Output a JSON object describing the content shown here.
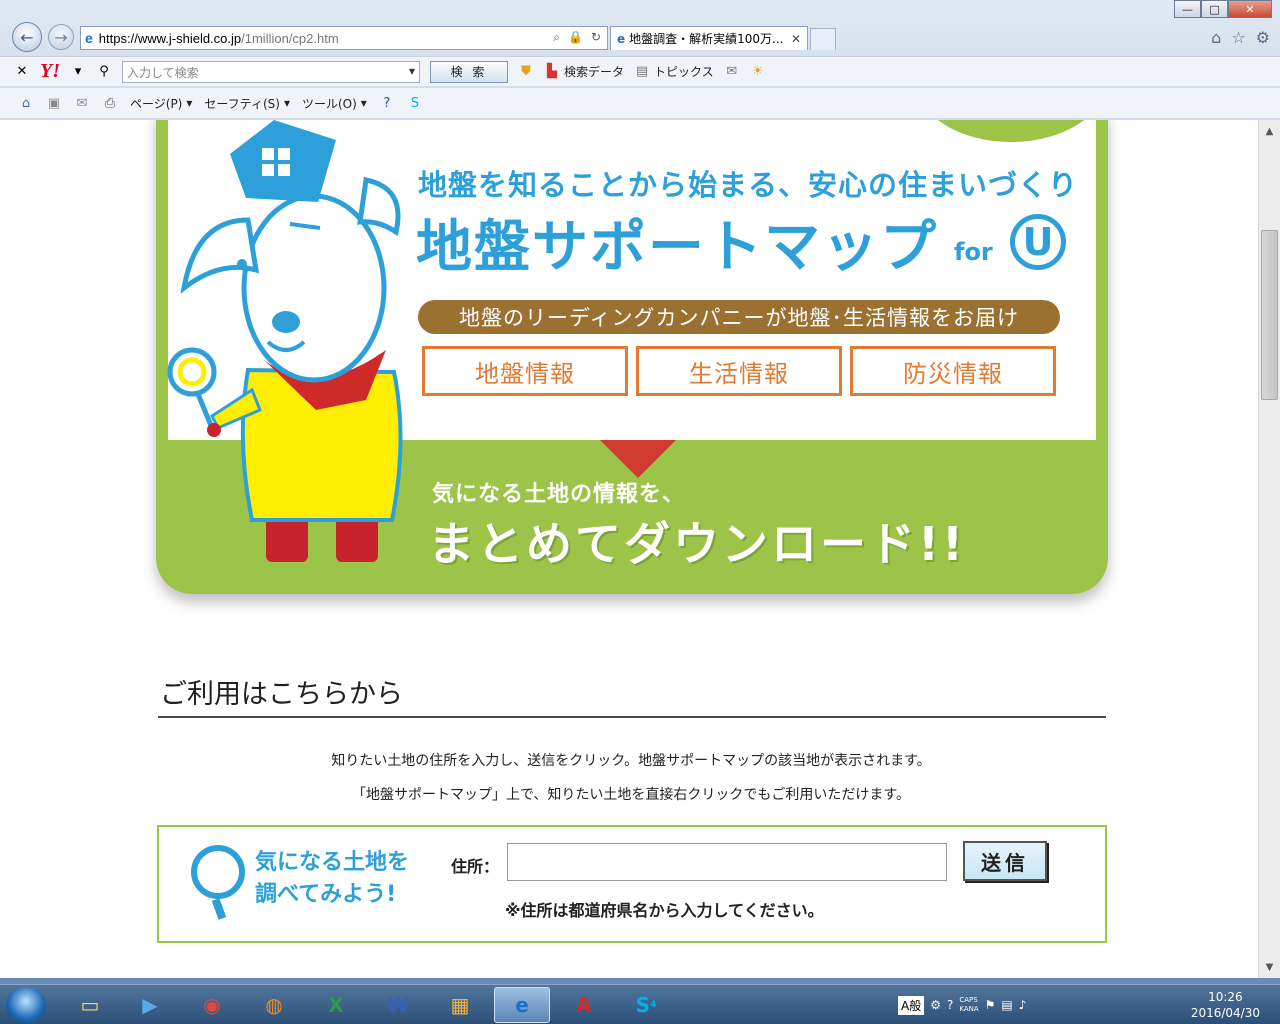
{
  "browser": {
    "url_host": "https://www.j-shield.co.jp",
    "url_path": "/1million/cp2.htm",
    "tab_title": "地盤調査・解析実績100万...",
    "window_buttons": [
      "—",
      "□",
      "✕"
    ]
  },
  "yahoo_toolbar": {
    "search_placeholder": "入力して検索",
    "search_button": "検 索",
    "search_data_label": "検索データ",
    "topics_label": "トピックス"
  },
  "command_bar": {
    "page_menu": "ページ(P)",
    "safety_menu": "セーフティ(S)",
    "tools_menu": "ツール(O)"
  },
  "banner": {
    "tagline": "地盤を知ることから始まる、安心の住まいづくり",
    "title": "地盤サポートマップ",
    "title_for": "for",
    "title_u": "U",
    "pill": "地盤のリーディングカンパニーが地盤･生活情報をお届け",
    "categories": [
      "地盤情報",
      "生活情報",
      "防災情報"
    ],
    "sub": "気になる土地の情報を、",
    "big": "まとめてダウンロード!!"
  },
  "section": {
    "title": "ご利用はこちらから",
    "desc1": "知りたい土地の住所を入力し、送信をクリック。地盤サポートマップの該当地が表示されます。",
    "desc2": "「地盤サポートマップ」上で、知りたい土地を直接右クリックでもご利用いただけます。"
  },
  "form": {
    "cta_line1": "気になる土地を",
    "cta_line2": "調べてみよう!",
    "address_label": "住所：",
    "address_value": "",
    "submit_label": "送信",
    "note": "※住所は都道府県名から入力してください。"
  },
  "taskbar": {
    "ime_mode": "A般",
    "caps": "CAPS",
    "kana": "KANA",
    "time": "10:26",
    "date": "2016/04/30",
    "skype_badge": "4"
  },
  "colors": {
    "brand_blue": "#2d9fd9",
    "brand_green": "#9cc448",
    "accent_orange": "#e07b33",
    "pill_brown": "#9a7131",
    "arrow_red": "#d03a2f"
  }
}
